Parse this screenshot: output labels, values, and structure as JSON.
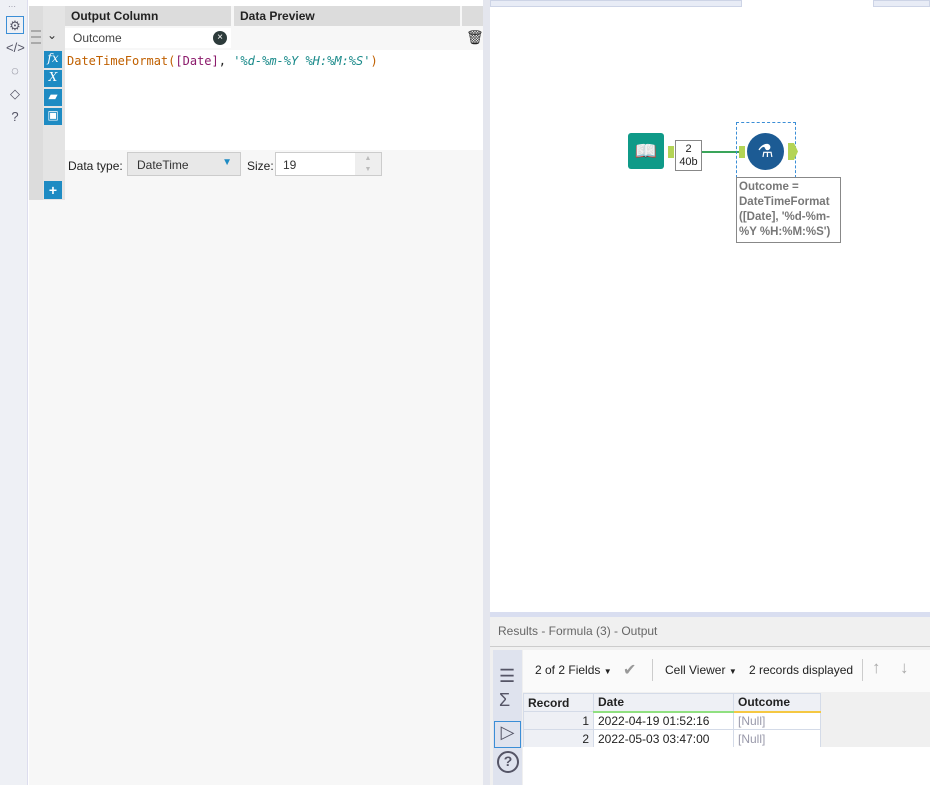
{
  "left_toolbar": {
    "icons": [
      "gear-icon",
      "code-icon",
      "annotation-icon",
      "tag-icon",
      "help-icon"
    ]
  },
  "grid": {
    "header_output": "Output Column",
    "header_preview": "Data Preview",
    "output_value": "Outcome",
    "expr_func": "DateTimeFormat",
    "expr_open": "(",
    "expr_field": "[Date]",
    "expr_comma": ", ",
    "expr_str": "'%d-%m-%Y %H:%M:%S'",
    "expr_close": ")",
    "datatype_label": "Data type:",
    "datatype_value": "DateTime",
    "size_label": "Size:",
    "size_value": "19"
  },
  "canvas": {
    "conn_count": "2",
    "conn_size": "40b",
    "annotation": "Outcome = DateTimeFormat ([Date], '%d-%m-%Y %H:%M:%S')"
  },
  "results": {
    "title": "Results - Formula (3) - Output",
    "fields": "2 of 2 Fields",
    "cell_viewer": "Cell Viewer",
    "records": "2 records displayed",
    "columns": [
      "Record",
      "Date",
      "Outcome"
    ],
    "rows": [
      [
        "1",
        "2022-04-19 01:52:16",
        "[Null]"
      ],
      [
        "2",
        "2022-05-03 03:47:00",
        "[Null]"
      ]
    ]
  }
}
